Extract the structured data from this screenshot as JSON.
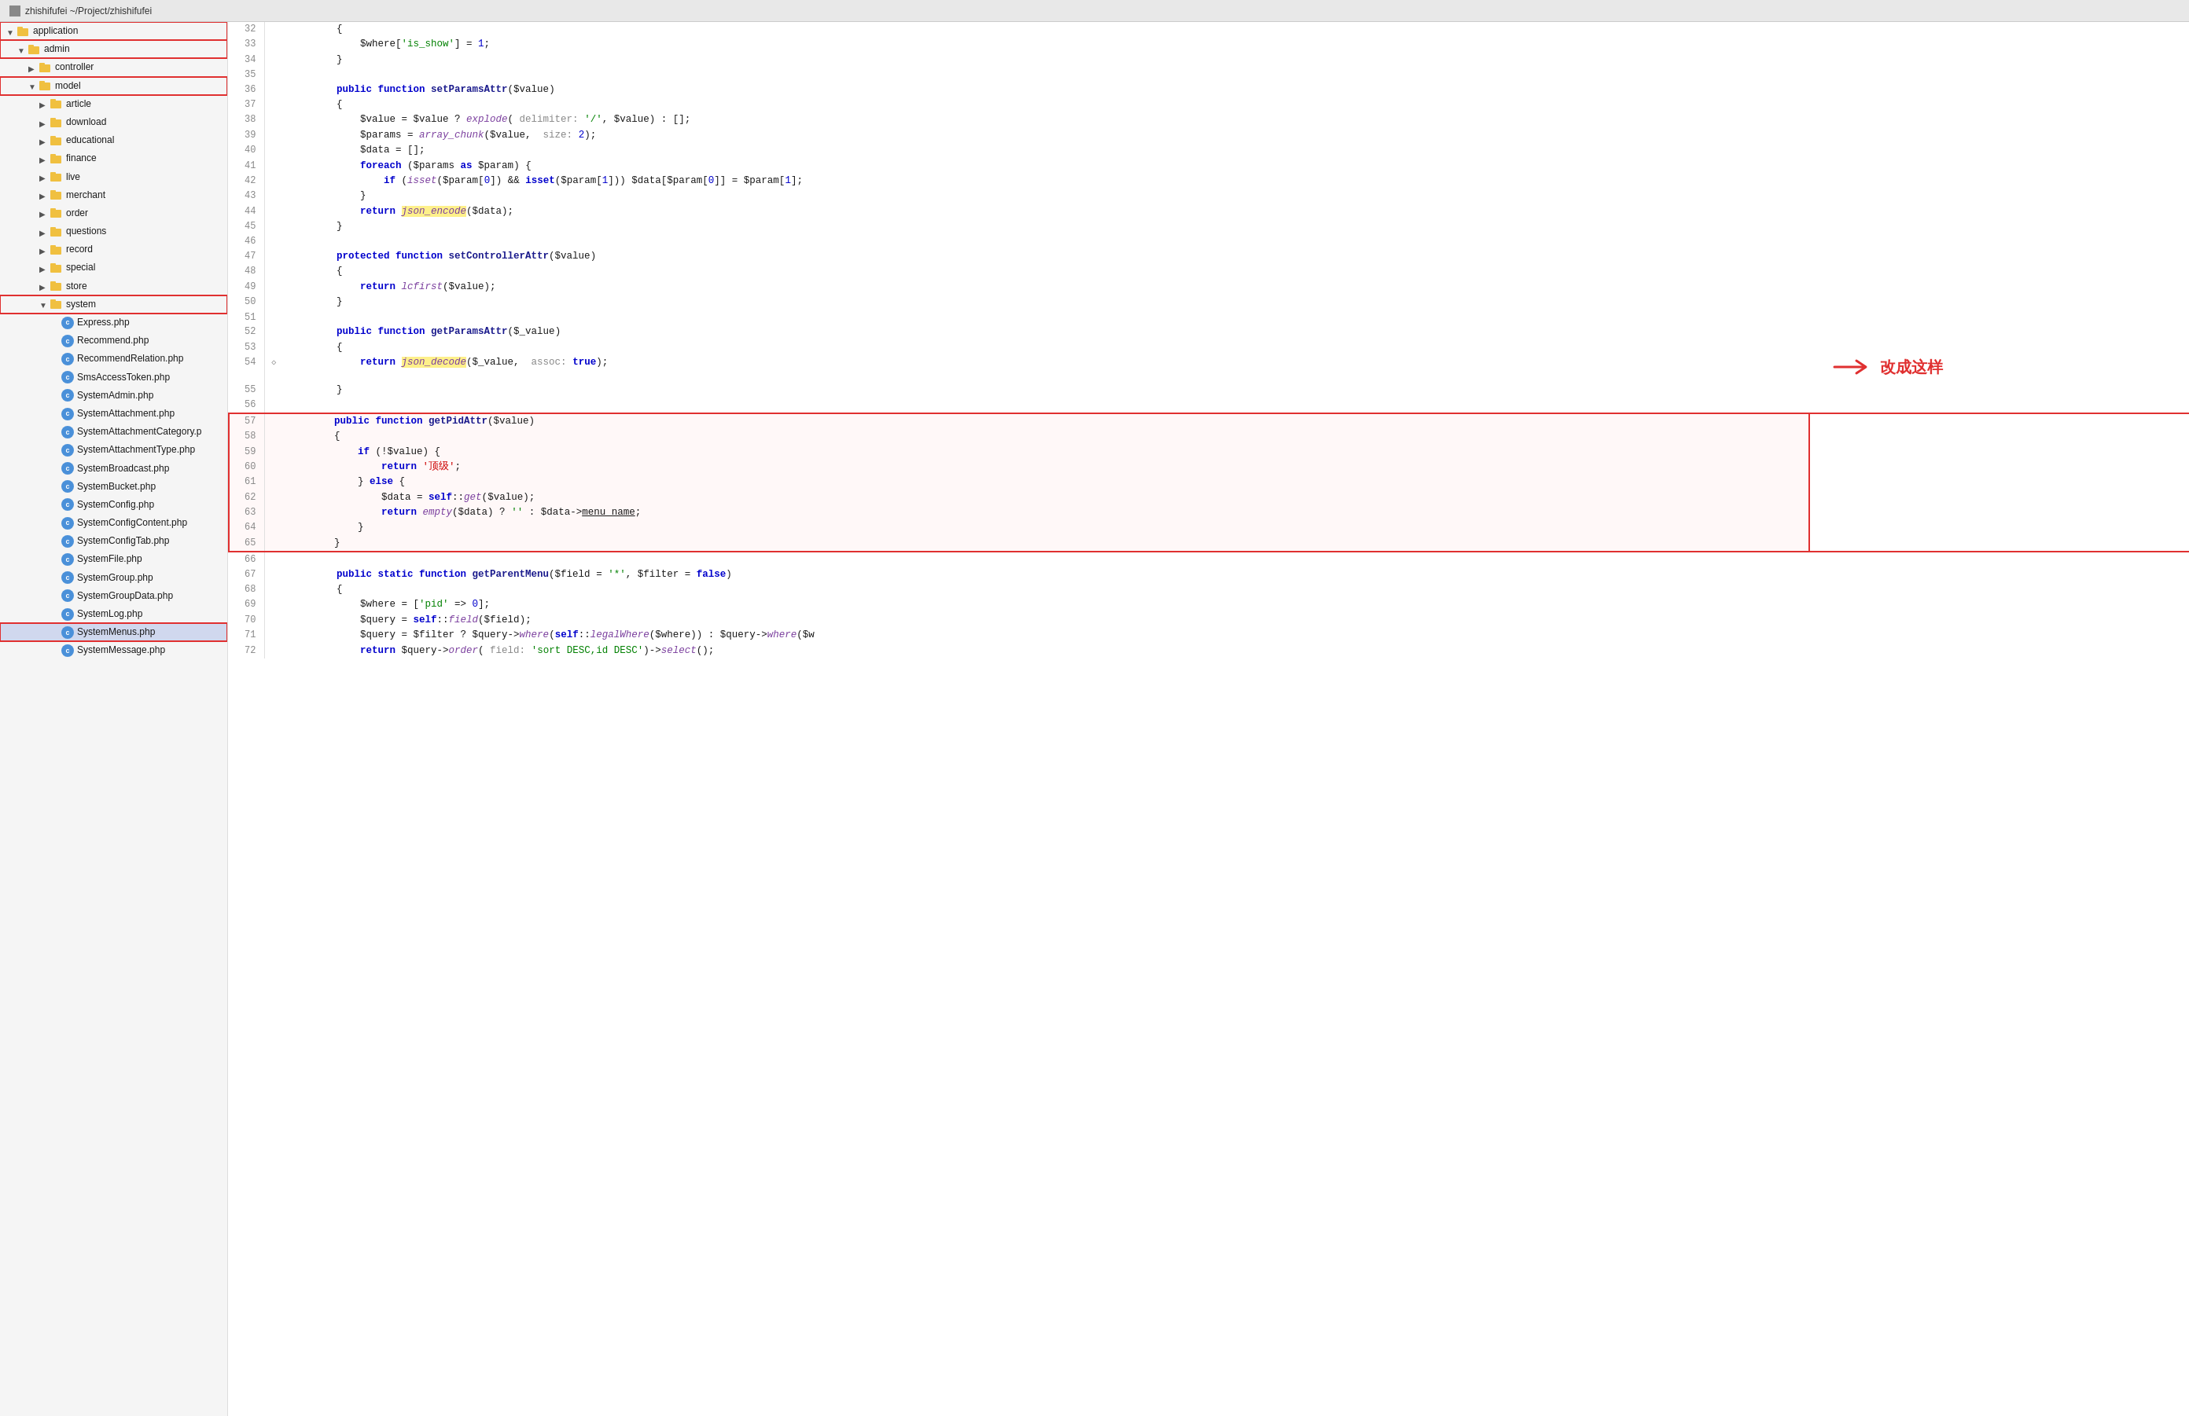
{
  "titlebar": {
    "icon_label": "zhishifufei-icon",
    "title": "zhishifufei ~/Project/zhishifufei"
  },
  "sidebar": {
    "items": [
      {
        "id": "application",
        "label": "application",
        "type": "folder",
        "indent": 1,
        "state": "open",
        "highlight": "red-border"
      },
      {
        "id": "admin",
        "label": "admin",
        "type": "folder",
        "indent": 2,
        "state": "open",
        "highlight": "red-border"
      },
      {
        "id": "controller",
        "label": "controller",
        "type": "folder",
        "indent": 3,
        "state": "closed",
        "highlight": ""
      },
      {
        "id": "model",
        "label": "model",
        "type": "folder",
        "indent": 3,
        "state": "open",
        "highlight": "red-border"
      },
      {
        "id": "article",
        "label": "article",
        "type": "folder",
        "indent": 4,
        "state": "closed",
        "highlight": ""
      },
      {
        "id": "download",
        "label": "download",
        "type": "folder",
        "indent": 4,
        "state": "closed",
        "highlight": ""
      },
      {
        "id": "educational",
        "label": "educational",
        "type": "folder",
        "indent": 4,
        "state": "closed",
        "highlight": ""
      },
      {
        "id": "finance",
        "label": "finance",
        "type": "folder",
        "indent": 4,
        "state": "closed",
        "highlight": ""
      },
      {
        "id": "live",
        "label": "live",
        "type": "folder",
        "indent": 4,
        "state": "closed",
        "highlight": ""
      },
      {
        "id": "merchant",
        "label": "merchant",
        "type": "folder",
        "indent": 4,
        "state": "closed",
        "highlight": ""
      },
      {
        "id": "order",
        "label": "order",
        "type": "folder",
        "indent": 4,
        "state": "closed",
        "highlight": ""
      },
      {
        "id": "questions",
        "label": "questions",
        "type": "folder",
        "indent": 4,
        "state": "closed",
        "highlight": ""
      },
      {
        "id": "record",
        "label": "record",
        "type": "folder",
        "indent": 4,
        "state": "closed",
        "highlight": ""
      },
      {
        "id": "special",
        "label": "special",
        "type": "folder",
        "indent": 4,
        "state": "closed",
        "highlight": ""
      },
      {
        "id": "store",
        "label": "store",
        "type": "folder",
        "indent": 4,
        "state": "closed",
        "highlight": ""
      },
      {
        "id": "system",
        "label": "system",
        "type": "folder",
        "indent": 4,
        "state": "open",
        "highlight": "red-border"
      },
      {
        "id": "Express",
        "label": "Express.php",
        "type": "php",
        "indent": 5,
        "state": "none",
        "highlight": ""
      },
      {
        "id": "Recommend",
        "label": "Recommend.php",
        "type": "php",
        "indent": 5,
        "state": "none",
        "highlight": ""
      },
      {
        "id": "RecommendRelation",
        "label": "RecommendRelation.php",
        "type": "php",
        "indent": 5,
        "state": "none",
        "highlight": ""
      },
      {
        "id": "SmsAccessToken",
        "label": "SmsAccessToken.php",
        "type": "php",
        "indent": 5,
        "state": "none",
        "highlight": ""
      },
      {
        "id": "SystemAdmin",
        "label": "SystemAdmin.php",
        "type": "php",
        "indent": 5,
        "state": "none",
        "highlight": ""
      },
      {
        "id": "SystemAttachment",
        "label": "SystemAttachment.php",
        "type": "php",
        "indent": 5,
        "state": "none",
        "highlight": ""
      },
      {
        "id": "SystemAttachmentCategory",
        "label": "SystemAttachmentCategory.p",
        "type": "php",
        "indent": 5,
        "state": "none",
        "highlight": ""
      },
      {
        "id": "SystemAttachmentType",
        "label": "SystemAttachmentType.php",
        "type": "php",
        "indent": 5,
        "state": "none",
        "highlight": ""
      },
      {
        "id": "SystemBroadcast",
        "label": "SystemBroadcast.php",
        "type": "php",
        "indent": 5,
        "state": "none",
        "highlight": ""
      },
      {
        "id": "SystemBucket",
        "label": "SystemBucket.php",
        "type": "php",
        "indent": 5,
        "state": "none",
        "highlight": ""
      },
      {
        "id": "SystemConfig",
        "label": "SystemConfig.php",
        "type": "php",
        "indent": 5,
        "state": "none",
        "highlight": ""
      },
      {
        "id": "SystemConfigContent",
        "label": "SystemConfigContent.php",
        "type": "php",
        "indent": 5,
        "state": "none",
        "highlight": ""
      },
      {
        "id": "SystemConfigTab",
        "label": "SystemConfigTab.php",
        "type": "php",
        "indent": 5,
        "state": "none",
        "highlight": ""
      },
      {
        "id": "SystemFile",
        "label": "SystemFile.php",
        "type": "php",
        "indent": 5,
        "state": "none",
        "highlight": ""
      },
      {
        "id": "SystemGroup",
        "label": "SystemGroup.php",
        "type": "php",
        "indent": 5,
        "state": "none",
        "highlight": ""
      },
      {
        "id": "SystemGroupData",
        "label": "SystemGroupData.php",
        "type": "php",
        "indent": 5,
        "state": "none",
        "highlight": ""
      },
      {
        "id": "SystemLog",
        "label": "SystemLog.php",
        "type": "php",
        "indent": 5,
        "state": "none",
        "highlight": ""
      },
      {
        "id": "SystemMenus",
        "label": "SystemMenus.php",
        "type": "php",
        "indent": 5,
        "state": "none",
        "highlight": "selected red-border"
      },
      {
        "id": "SystemMessage",
        "label": "SystemMessage.php",
        "type": "php",
        "indent": 5,
        "state": "none",
        "highlight": ""
      }
    ]
  },
  "editor": {
    "lines": [
      {
        "num": 32,
        "content_html": "        {"
      },
      {
        "num": 33,
        "content_html": "            <span class='var'>$where</span>[<span class='str'>'is_show'</span>] = <span class='num'>1</span>;"
      },
      {
        "num": 34,
        "content_html": "        }"
      },
      {
        "num": 35,
        "content_html": ""
      },
      {
        "num": 36,
        "content_html": "        <span class='kw'>public function</span> <span class='fn'>setParamsAttr</span>(<span class='var'>$value</span>)"
      },
      {
        "num": 37,
        "content_html": "        {"
      },
      {
        "num": 38,
        "content_html": "            <span class='var'>$value</span> = <span class='var'>$value</span> ? <span class='func-call'>explode</span>( <span class='param-hint'>delimiter:</span> <span class='str'>'/'</span>, <span class='var'>$value</span>) : [];"
      },
      {
        "num": 39,
        "content_html": "            <span class='var'>$params</span> = <span class='func-call'>array_chunk</span>(<span class='var'>$value</span>,  <span class='param-hint'>size:</span> <span class='num'>2</span>);"
      },
      {
        "num": 40,
        "content_html": "            <span class='var'>$data</span> = [];"
      },
      {
        "num": 41,
        "content_html": "            <span class='kw'>foreach</span> (<span class='var'>$params</span> <span class='kw'>as</span> <span class='var'>$param</span>) {"
      },
      {
        "num": 42,
        "content_html": "                <span class='kw'>if</span> (<span class='func-call'>isset</span>(<span class='var'>$param</span>[<span class='num'>0</span>]) &amp;&amp; <span class='kw'>isset</span>(<span class='var'>$param</span>[<span class='num'>1</span>])) <span class='var'>$data</span>[<span class='var'>$param</span>[<span class='num'>0</span>]] = <span class='var'>$param</span>[<span class='num'>1</span>];"
      },
      {
        "num": 43,
        "content_html": "            }"
      },
      {
        "num": 44,
        "content_html": "            <span class='kw'>return</span> <span class='highlight-yellow'><span class='func-call'>json_encode</span></span>(<span class='var'>$data</span>);"
      },
      {
        "num": 45,
        "content_html": "        }"
      },
      {
        "num": 46,
        "content_html": ""
      },
      {
        "num": 47,
        "content_html": "        <span class='kw'>protected function</span> <span class='fn'>setControllerAttr</span>(<span class='var'>$value</span>)"
      },
      {
        "num": 48,
        "content_html": "        {"
      },
      {
        "num": 49,
        "content_html": "            <span class='kw'>return</span> <span class='func-call'>lcfirst</span>(<span class='var'>$value</span>);"
      },
      {
        "num": 50,
        "content_html": "        }"
      },
      {
        "num": 51,
        "content_html": ""
      },
      {
        "num": 52,
        "content_html": "        <span class='kw'>public function</span> <span class='fn'>getParamsAttr</span>(<span class='var'>$_value</span>)"
      },
      {
        "num": 53,
        "content_html": "        {"
      },
      {
        "num": 54,
        "content_html": "            <span class='kw'>return</span> <span class='highlight-yellow'><span class='func-call'>json_decode</span></span>(<span class='var'>$_value</span>,  <span class='param-hint'>assoc:</span> <span class='kw'>true</span>);"
      },
      {
        "num": 55,
        "content_html": "        }"
      },
      {
        "num": 56,
        "content_html": ""
      },
      {
        "num": 57,
        "content_html": "        <span class='kw'>public function</span> <span class='fn'>getPidAttr</span>(<span class='var'>$value</span>)",
        "highlight": true
      },
      {
        "num": 58,
        "content_html": "        {",
        "highlight": true
      },
      {
        "num": 59,
        "content_html": "            <span class='kw'>if</span> (!<span class='var'>$value</span>) {",
        "highlight": true
      },
      {
        "num": 60,
        "content_html": "                <span class='kw'>return</span> <span class='str-red'>'顶级'</span>;",
        "highlight": true
      },
      {
        "num": 61,
        "content_html": "            } <span class='kw'>else</span> {",
        "highlight": true
      },
      {
        "num": 62,
        "content_html": "                <span class='var'>$data</span> = <span class='kw'>self</span>::<span class='func-call'>get</span>(<span class='var'>$value</span>);",
        "highlight": true
      },
      {
        "num": 63,
        "content_html": "                <span class='kw'>return</span> <span class='func-call'>empty</span>(<span class='var'>$data</span>) ? <span class='str'>''</span> : <span class='var'>$data</span>-&gt;<span class='prop'>menu_name</span>;",
        "highlight": true
      },
      {
        "num": 64,
        "content_html": "            }",
        "highlight": true
      },
      {
        "num": 65,
        "content_html": "        }",
        "highlight": true
      },
      {
        "num": 66,
        "content_html": ""
      },
      {
        "num": 67,
        "content_html": "        <span class='kw'>public static function</span> <span class='fn'>getParentMenu</span>(<span class='var'>$field</span> = <span class='str'>'*'</span>, <span class='var'>$filter</span> = <span class='kw'>false</span>)"
      },
      {
        "num": 68,
        "content_html": "        {"
      },
      {
        "num": 69,
        "content_html": "            <span class='var'>$where</span> = [<span class='str'>'pid'</span> =&gt; <span class='num'>0</span>];"
      },
      {
        "num": 70,
        "content_html": "            <span class='var'>$query</span> = <span class='kw'>self</span>::<span class='func-call'>field</span>(<span class='var'>$field</span>);"
      },
      {
        "num": 71,
        "content_html": "            <span class='var'>$query</span> = <span class='var'>$filter</span> ? <span class='var'>$query</span>-&gt;<span class='func-call'>where</span>(<span class='kw'>self</span>::<span class='func-call'>legalWhere</span>(<span class='var'>$where</span>)) : <span class='var'>$query</span>-&gt;<span class='func-call'>where</span>(<span class='var'>$w</span>"
      },
      {
        "num": 72,
        "content_html": "            <span class='kw'>return</span> <span class='var'>$query</span>-&gt;<span class='func-call'>order</span>( <span class='param-hint'>field:</span> <span class='str'>'sort DESC,id DESC'</span>)-&gt;<span class='func-call'>select</span>();"
      }
    ],
    "annotation": {
      "arrow_text": "→",
      "label": "改成这样"
    }
  }
}
